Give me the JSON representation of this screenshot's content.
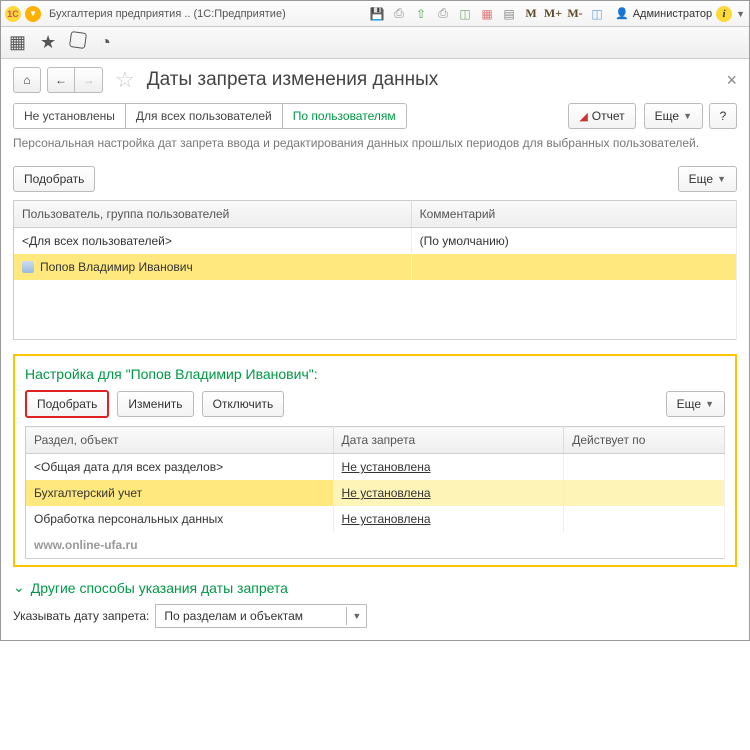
{
  "titlebar": {
    "logo_text": "1C",
    "title": "Бухгалтерия предприятия .. (1С:Предприятие)",
    "admin_label": "Администратор",
    "mem_m": "M",
    "mem_mp": "M+",
    "mem_mm": "M-"
  },
  "page": {
    "title": "Даты запрета изменения данных",
    "close": "×"
  },
  "tabs": {
    "t0": "Не установлены",
    "t1": "Для всех пользователей",
    "t2": "По пользователям"
  },
  "top_buttons": {
    "report": "Отчет",
    "more": "Еще",
    "help": "?"
  },
  "description": "Персональная настройка дат запрета ввода и редактирования данных прошлых периодов для выбранных пользователей.",
  "users_section": {
    "pick": "Подобрать",
    "more": "Еще",
    "col_user": "Пользователь, группа пользователей",
    "col_comment": "Комментарий",
    "row0_user": "<Для всех пользователей>",
    "row0_comment": "(По умолчанию)",
    "row1_user": "Попов Владимир Иванович"
  },
  "settings_section": {
    "title": "Настройка для \"Попов Владимир Иванович\":",
    "pick": "Подобрать",
    "edit": "Изменить",
    "disable": "Отключить",
    "more": "Еще",
    "col_section": "Раздел, объект",
    "col_date": "Дата запрета",
    "col_valid": "Действует по",
    "r0_section": "<Общая дата для всех разделов>",
    "r0_date": "Не установлена",
    "r1_section": "Бухгалтерский учет",
    "r1_date": "Не установлена",
    "r2_section": "Обработка персональных данных",
    "r2_date": "Не установлена",
    "watermark": "www.online-ufa.ru"
  },
  "other": {
    "title": "Другие способы указания даты запрета",
    "label": "Указывать дату запрета:",
    "value": "По разделам и объектам"
  }
}
